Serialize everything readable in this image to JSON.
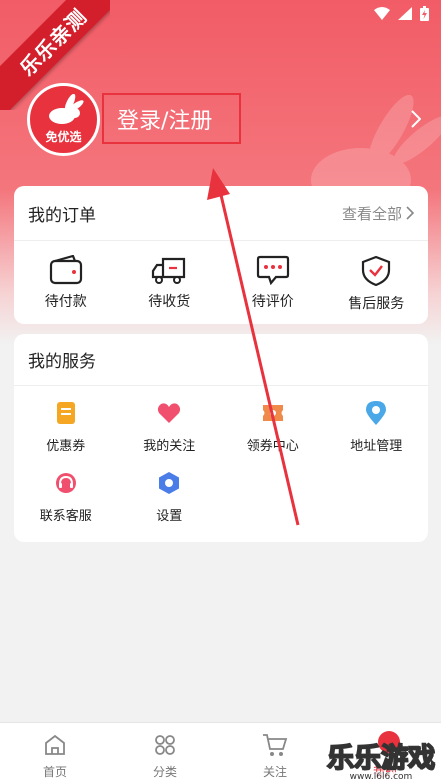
{
  "ribbon": {
    "text": "乐乐亲测"
  },
  "header": {
    "avatar_text": "免优选",
    "login_label": "登录/注册"
  },
  "orders": {
    "title": "我的订单",
    "view_all": "查看全部",
    "items": [
      {
        "label": "待付款",
        "icon": "wallet-icon"
      },
      {
        "label": "待收货",
        "icon": "truck-icon"
      },
      {
        "label": "待评价",
        "icon": "chat-icon"
      },
      {
        "label": "售后服务",
        "icon": "shield-icon"
      }
    ]
  },
  "services": {
    "title": "我的服务",
    "items": [
      {
        "label": "优惠券",
        "icon": "coupon-icon"
      },
      {
        "label": "我的关注",
        "icon": "heart-icon"
      },
      {
        "label": "领券中心",
        "icon": "ticket-center-icon"
      },
      {
        "label": "地址管理",
        "icon": "location-icon"
      },
      {
        "label": "联系客服",
        "icon": "headset-icon"
      },
      {
        "label": "设置",
        "icon": "settings-icon"
      }
    ]
  },
  "bottom_nav": {
    "items": [
      {
        "label": "首页",
        "icon": "home-icon"
      },
      {
        "label": "分类",
        "icon": "category-icon"
      },
      {
        "label": "关注",
        "icon": "cart-icon"
      },
      {
        "label": "我的",
        "icon": "profile-icon"
      }
    ]
  },
  "watermark": {
    "main": "乐乐游戏",
    "sub": "www.l6l6.com"
  },
  "colors": {
    "accent": "#e8323e",
    "header": "#f25c66"
  }
}
